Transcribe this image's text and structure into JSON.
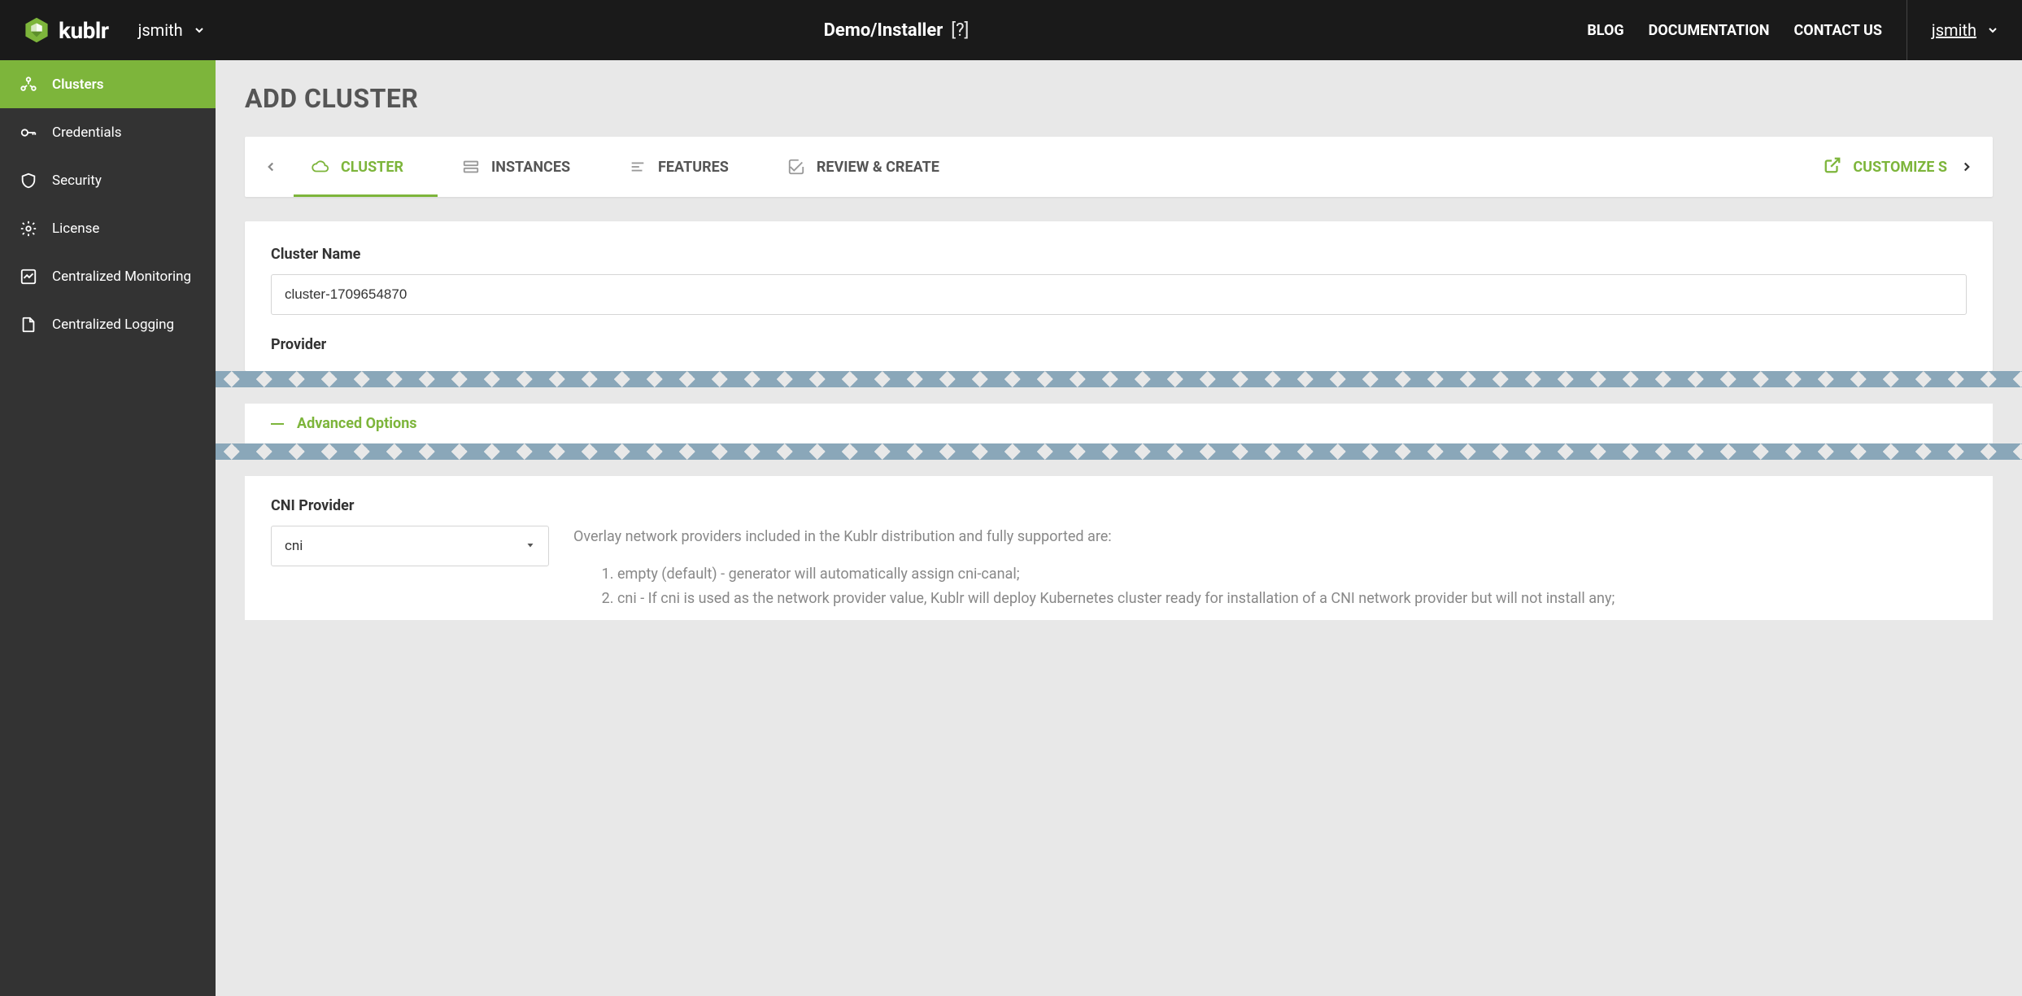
{
  "brand": "kublr",
  "context_user": "jsmith",
  "breadcrumb": "Demo/Installer",
  "help_marker": "[?]",
  "topnav": {
    "blog": "BLOG",
    "docs": "DOCUMENTATION",
    "contact": "CONTACT US"
  },
  "user_menu": "jsmith",
  "sidebar": {
    "items": [
      {
        "label": "Clusters"
      },
      {
        "label": "Credentials"
      },
      {
        "label": "Security"
      },
      {
        "label": "License"
      },
      {
        "label": "Centralized Monitoring"
      },
      {
        "label": "Centralized Logging"
      }
    ]
  },
  "page_title": "ADD CLUSTER",
  "tabs": {
    "cluster": "CLUSTER",
    "instances": "INSTANCES",
    "features": "FEATURES",
    "review": "REVIEW & CREATE",
    "customize": "CUSTOMIZE S"
  },
  "form": {
    "cluster_name_label": "Cluster Name",
    "cluster_name_value": "cluster-1709654870",
    "provider_label": "Provider",
    "advanced_label": "Advanced Options",
    "cni_label": "CNI Provider",
    "cni_value": "cni",
    "cni_description_intro": "Overlay network providers included in the Kublr distribution and fully supported are:",
    "cni_options": [
      "empty (default) - generator will automatically assign cni-canal;",
      "cni - If cni is used as the network provider value, Kublr will deploy Kubernetes cluster ready for installation of a CNI network provider but will not install any;"
    ]
  }
}
